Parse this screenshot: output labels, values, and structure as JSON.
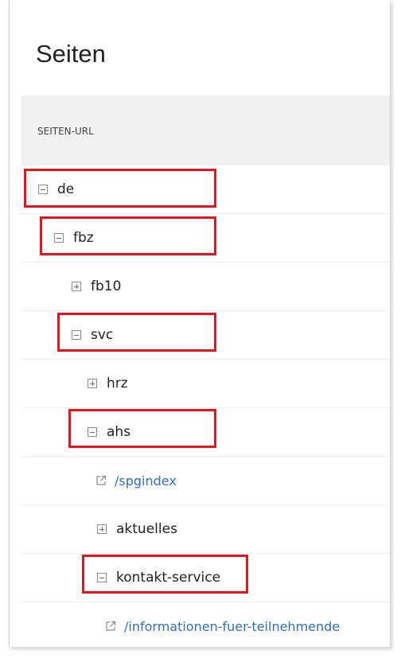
{
  "page": {
    "title": "Seiten"
  },
  "table": {
    "column_header": "SEITEN-URL"
  },
  "tree": {
    "nodes": [
      {
        "label": "de",
        "type": "folder",
        "state": "expanded",
        "depth": 0,
        "highlighted": true
      },
      {
        "label": "fbz",
        "type": "folder",
        "state": "expanded",
        "depth": 1,
        "highlighted": true
      },
      {
        "label": "fb10",
        "type": "folder",
        "state": "collapsed",
        "depth": 2,
        "highlighted": false
      },
      {
        "label": "svc",
        "type": "folder",
        "state": "expanded",
        "depth": 2,
        "highlighted": true
      },
      {
        "label": "hrz",
        "type": "folder",
        "state": "collapsed",
        "depth": 3,
        "highlighted": false
      },
      {
        "label": "ahs",
        "type": "folder",
        "state": "expanded",
        "depth": 3,
        "highlighted": true
      },
      {
        "label": "/spgindex",
        "type": "page-link",
        "depth": 4,
        "highlighted": false
      },
      {
        "label": "aktuelles",
        "type": "folder",
        "state": "collapsed",
        "depth": 4,
        "highlighted": false
      },
      {
        "label": "kontakt-service",
        "type": "folder",
        "state": "expanded",
        "depth": 4,
        "highlighted": true
      },
      {
        "label": "/informationen-fuer-teilnehmende",
        "type": "page-link",
        "depth": 5,
        "highlighted": false
      }
    ]
  },
  "colors": {
    "highlight": "#e8141a",
    "link": "#2d6fc2",
    "header_bg": "#f0f0f0"
  },
  "icons": {
    "expanded": "minus-box-icon",
    "collapsed": "plus-box-icon",
    "link": "external-link-icon"
  }
}
